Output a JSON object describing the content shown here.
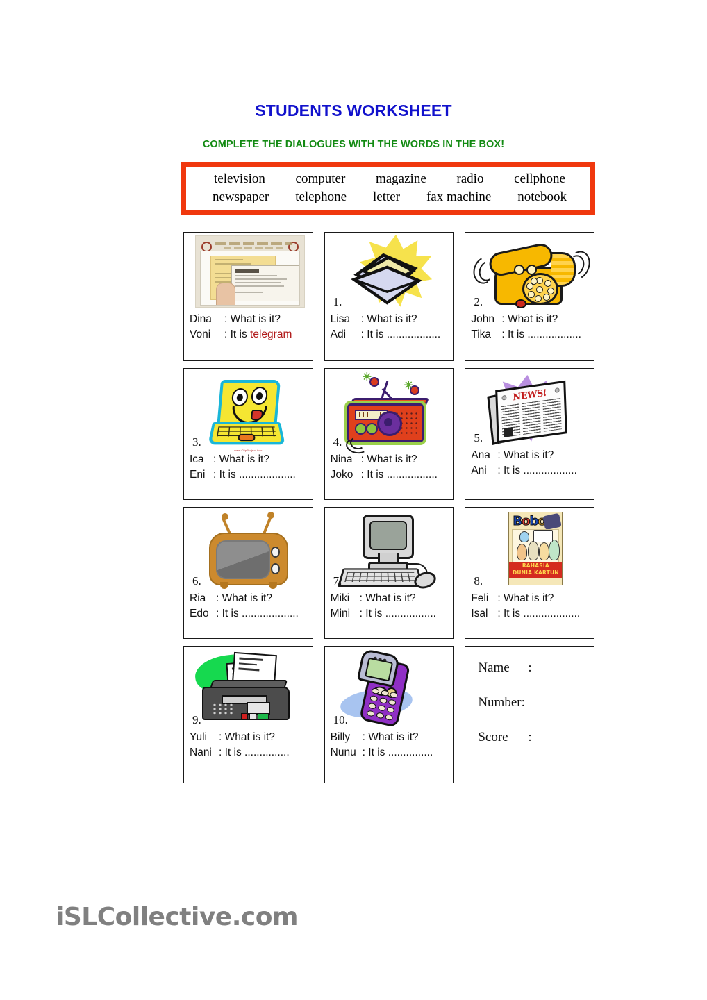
{
  "header": {
    "title": "STUDENTS WORKSHEET",
    "instruction": "COMPLETE THE DIALOGUES WITH THE WORDS IN THE BOX!",
    "title_color": "#1111cc",
    "instruction_color": "#128a12"
  },
  "word_box": {
    "border_color": "#f0380e",
    "row1": [
      "television",
      "computer",
      "magazine",
      "radio",
      "cellphone"
    ],
    "row2": [
      "newspaper",
      "telephone",
      "letter",
      "fax machine",
      "notebook"
    ]
  },
  "cards": [
    {
      "number": "",
      "icon": "telegram-photo-icon",
      "speaker_a": "Dina",
      "speaker_b": "Voni",
      "question": ": What is it?",
      "answer_prefix": ": It is",
      "answer": "telegram",
      "answer_color": "#b01818",
      "blank": ""
    },
    {
      "number": "1.",
      "icon": "letter-envelope-icon",
      "speaker_a": "Lisa",
      "speaker_b": "Adi",
      "question": ": What is it?",
      "answer_prefix": ": It is",
      "answer": "",
      "blank": ".................."
    },
    {
      "number": "2.",
      "icon": "telephone-icon",
      "speaker_a": "John",
      "speaker_b": "Tika",
      "question": ": What is it?",
      "answer_prefix": ": It is",
      "answer": "",
      "blank": ".................."
    },
    {
      "number": "3.",
      "icon": "notebook-laptop-icon",
      "speaker_a": "Ica",
      "speaker_b": "Eni",
      "question": ": What is it?",
      "answer_prefix": ": It is",
      "answer": "",
      "blank": "..................."
    },
    {
      "number": "4.",
      "icon": "radio-icon",
      "speaker_a": "Nina",
      "speaker_b": "Joko",
      "question": ": What is it?",
      "answer_prefix": ": It is",
      "answer": "",
      "blank": "................."
    },
    {
      "number": "5.",
      "icon": "newspaper-icon",
      "speaker_a": "Ana",
      "speaker_b": "Ani",
      "question": ": What is it?",
      "answer_prefix": ": It is",
      "answer": "",
      "blank": ".................."
    },
    {
      "number": "6.",
      "icon": "television-icon",
      "speaker_a": "Ria",
      "speaker_b": "Edo",
      "question": ": What is it?",
      "answer_prefix": ": It is",
      "answer": "",
      "blank": "..................."
    },
    {
      "number": "7.",
      "icon": "computer-icon",
      "speaker_a": "Miki",
      "speaker_b": "Mini",
      "question": ": What is it?",
      "answer_prefix": ": It is",
      "answer": "",
      "blank": "................."
    },
    {
      "number": "8.",
      "icon": "magazine-icon",
      "speaker_a": "Feli",
      "speaker_b": "Isal",
      "question": ": What is it?",
      "answer_prefix": ": It is",
      "answer": "",
      "blank": "..................."
    },
    {
      "number": "9.",
      "icon": "fax-machine-icon",
      "speaker_a": "Yuli",
      "speaker_b": "Nani",
      "question": ": What is it?",
      "answer_prefix": ": It is",
      "answer": "",
      "blank": "..............."
    },
    {
      "number": "10.",
      "icon": "cellphone-icon",
      "speaker_a": "Billy",
      "speaker_b": "Nunu",
      "question": ": What is it?",
      "answer_prefix": ": It is",
      "answer": "",
      "blank": "..............."
    }
  ],
  "info_card": {
    "name_label": "Name",
    "name_colon": ":",
    "number_label": "Number:",
    "number_colon": "",
    "score_label": "Score",
    "score_colon": ":"
  },
  "magazine_cover": {
    "logo": "Bobo",
    "banner_line1": "RAHASIA",
    "banner_line2": "DUNIA KARTUN"
  },
  "newspaper": {
    "masthead": "NEWS!"
  },
  "laptop": {
    "caption": "www.ClipProject.info"
  },
  "watermark": {
    "text": "iSLCollective.com"
  }
}
